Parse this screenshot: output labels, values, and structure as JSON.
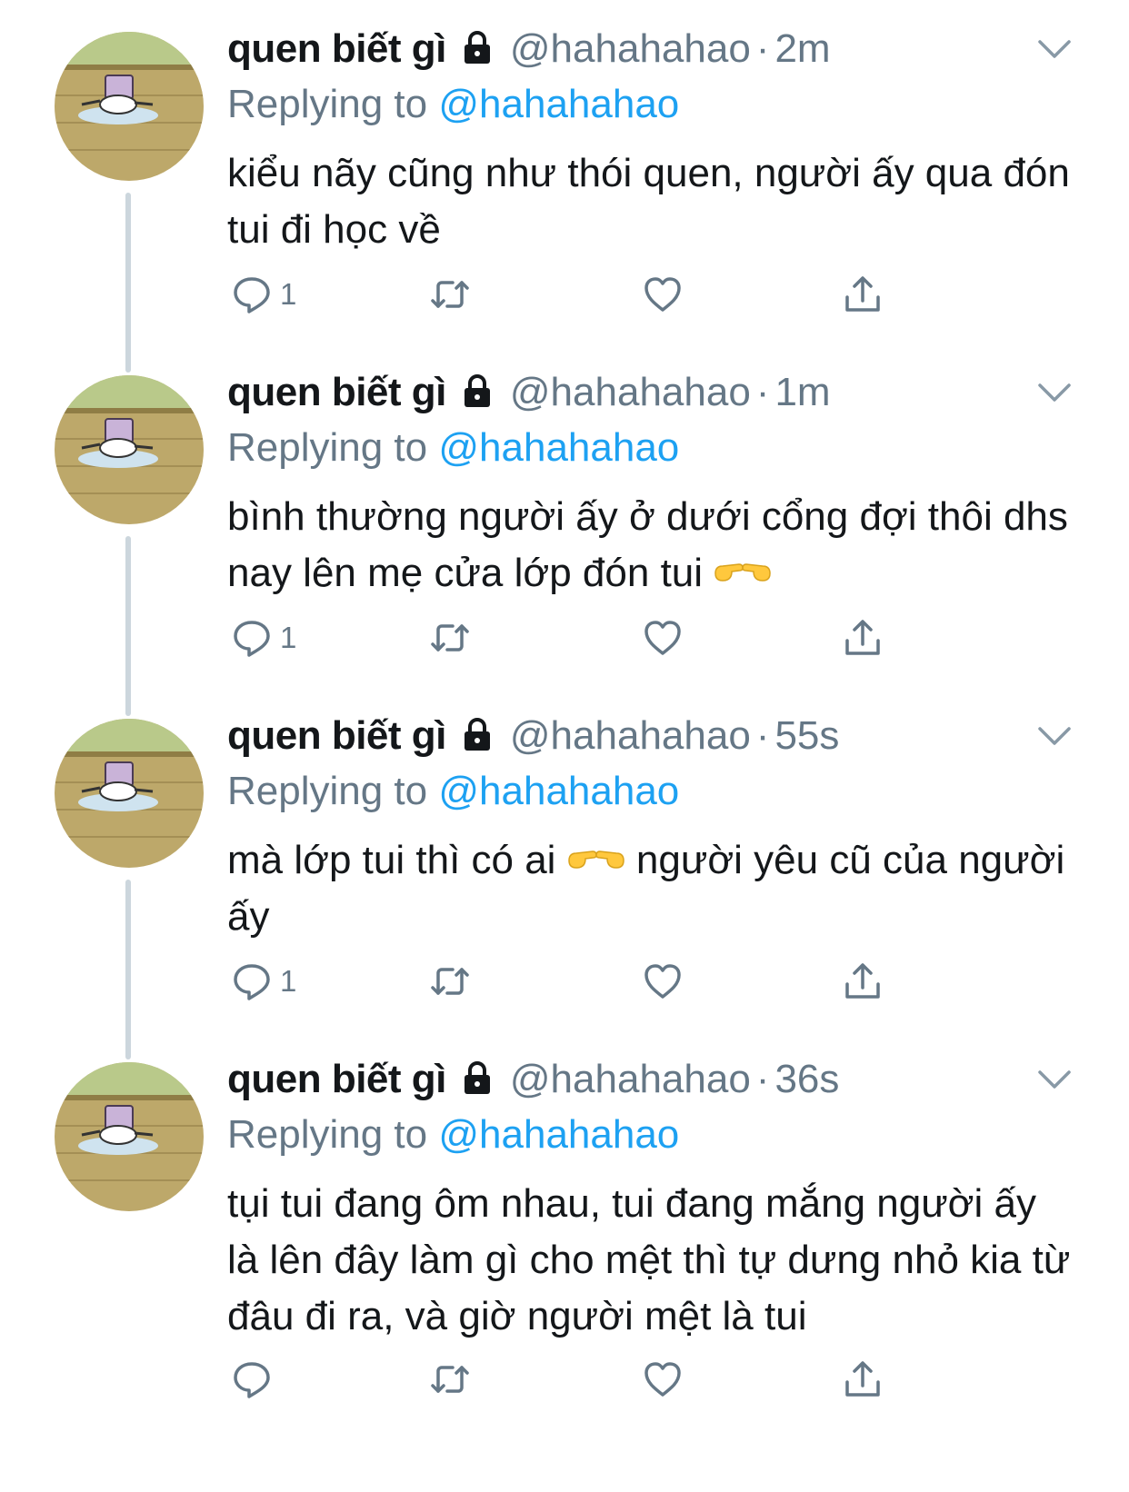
{
  "tweets": [
    {
      "display_name": "quen biết gì",
      "handle": "@hahahahao",
      "separator": "·",
      "time": "2m",
      "replying_label": "Replying to",
      "replying_handle": "@hahahahao",
      "text_parts": [
        "kiểu nãy cũng như thói quen, người ấy qua đón tui đi học về"
      ],
      "reply_count": "1",
      "has_thread_line": true
    },
    {
      "display_name": "quen biết gì",
      "handle": "@hahahahao",
      "separator": "·",
      "time": "1m",
      "replying_label": "Replying to",
      "replying_handle": "@hahahahao",
      "text_parts": [
        "bình thường người ấy ở dưới cổng đợi thôi dhs nay lên mẹ cửa lớp đón tui",
        ""
      ],
      "reply_count": "1",
      "has_thread_line": true
    },
    {
      "display_name": "quen biết gì",
      "handle": "@hahahahao",
      "separator": "·",
      "time": "55s",
      "replying_label": "Replying to",
      "replying_handle": "@hahahahao",
      "text_parts": [
        "mà lớp tui thì có ai",
        " người yêu cũ của người ấy"
      ],
      "reply_count": "1",
      "has_thread_line": true
    },
    {
      "display_name": "quen biết gì",
      "handle": "@hahahahao",
      "separator": "·",
      "time": "36s",
      "replying_label": "Replying to",
      "replying_handle": "@hahahahao",
      "text_parts": [
        "tụi tui đang ôm nhau, tui đang mắng người ấy là lên đây làm gì cho mệt thì tự dưng nhỏ kia từ đâu đi ra, và giờ người mệt là tui"
      ],
      "reply_count": "",
      "has_thread_line": false
    }
  ],
  "icons": {
    "lock": "lock-icon",
    "chevron": "chevron-down-icon",
    "reply": "reply-icon",
    "retweet": "retweet-icon",
    "like": "heart-icon",
    "share": "share-icon",
    "pointing": "pointing-hands-emoji"
  },
  "colors": {
    "text": "#14171a",
    "secondary": "#657786",
    "link": "#1da1f2",
    "thread_line": "#ccd6dd"
  }
}
